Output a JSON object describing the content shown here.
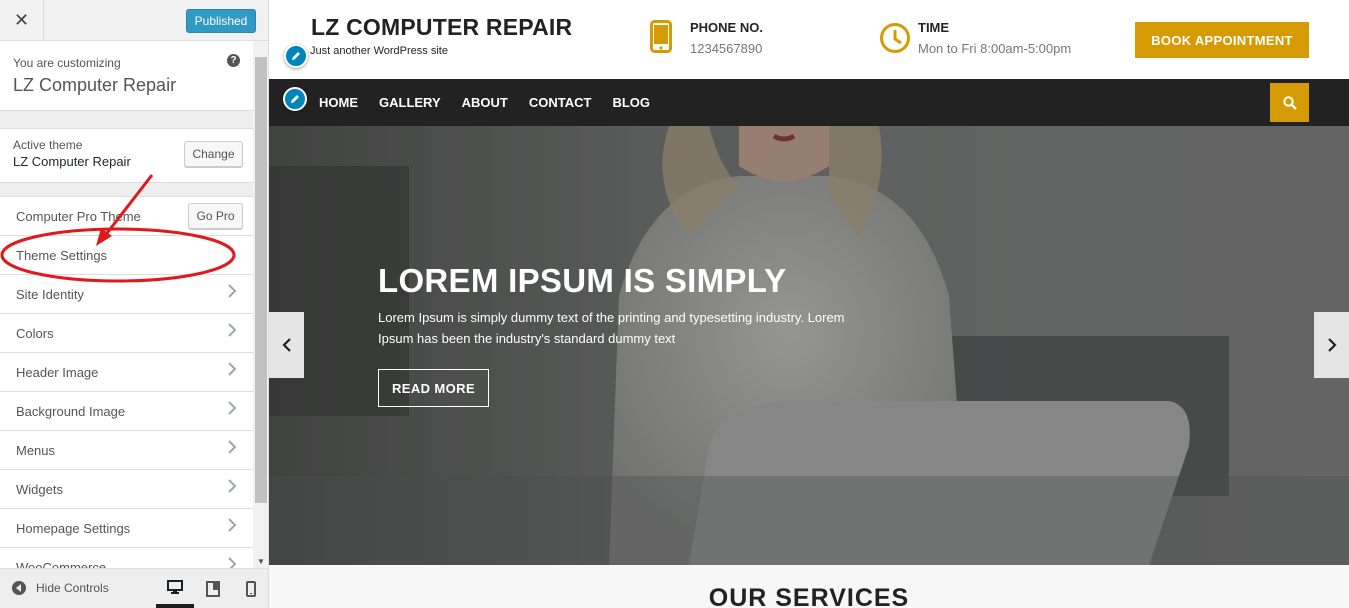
{
  "customizer": {
    "close_glyph": "✕",
    "publish_label": "Published",
    "customizing_small": "You are customizing",
    "customizing_site": "LZ Computer Repair",
    "help_glyph": "?",
    "active_theme_label": "Active theme",
    "active_theme_name": "LZ Computer Repair",
    "change_label": "Change",
    "gopro_label": "Go Pro",
    "sections": [
      {
        "label": "Computer Pro Theme"
      },
      {
        "label": "Theme Settings"
      },
      {
        "label": "Site Identity"
      },
      {
        "label": "Colors"
      },
      {
        "label": "Header Image"
      },
      {
        "label": "Background Image"
      },
      {
        "label": "Menus"
      },
      {
        "label": "Widgets"
      },
      {
        "label": "Homepage Settings"
      },
      {
        "label": "WooCommerce"
      }
    ],
    "hide_controls_label": "Hide Controls",
    "devices": [
      "desktop-icon",
      "tablet-icon",
      "mobile-icon"
    ],
    "annotation_color": "#e0191c"
  },
  "site": {
    "title": "LZ COMPUTER REPAIR",
    "tagline": "Just another WordPress site",
    "phone_label": "PHONE NO.",
    "phone_value": "1234567890",
    "time_label": "TIME",
    "time_value": "Mon to Fri 8:00am-5:00pm",
    "book_label": "BOOK APPOINTMENT",
    "accent_color": "#d69a04",
    "nav": [
      "HOME",
      "GALLERY",
      "ABOUT",
      "CONTACT",
      "BLOG"
    ],
    "hero": {
      "title": "LOREM IPSUM IS SIMPLY",
      "text": "Lorem Ipsum is simply dummy text of the printing and typesetting industry. Lorem Ipsum has been the industry's standard dummy text",
      "button": "READ MORE"
    },
    "services_title": "OUR SERVICES"
  }
}
